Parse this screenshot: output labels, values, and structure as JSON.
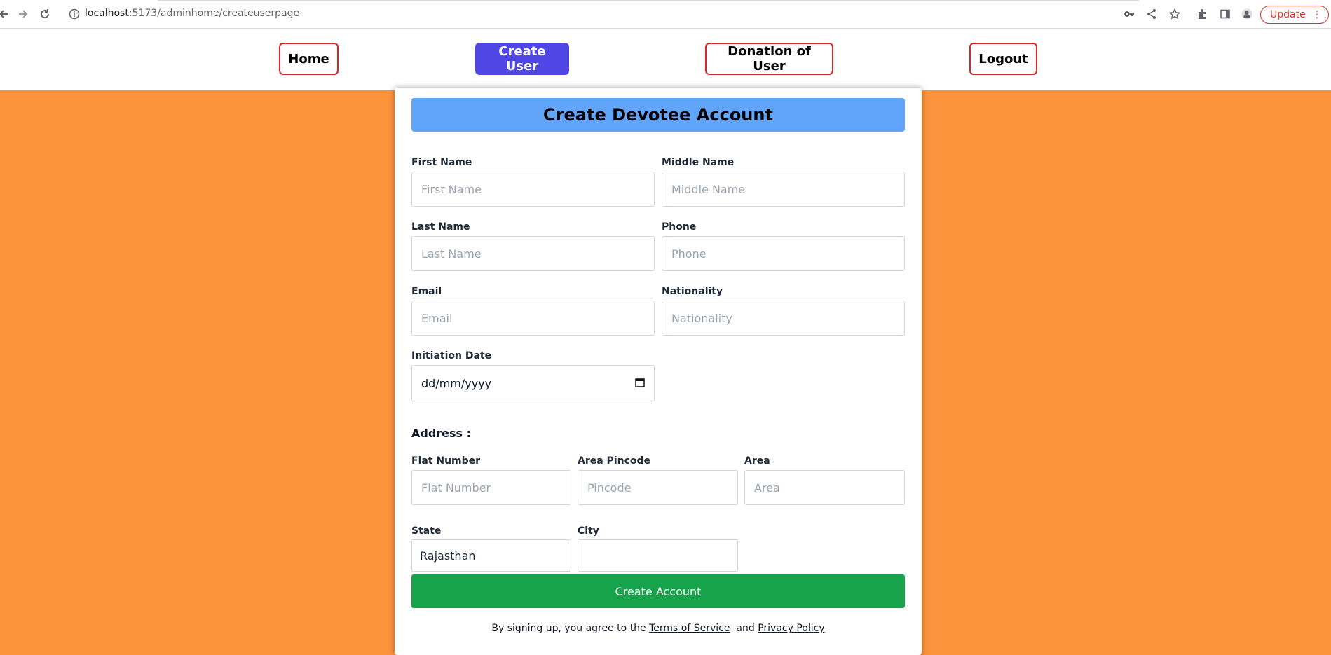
{
  "browser": {
    "url_host": "localhost",
    "url_path": ":5173/adminhome/createuserpage",
    "update_label": "Update",
    "colors": {
      "update": "#d93025"
    }
  },
  "nav": {
    "home": "Home",
    "create_user": "Create User",
    "donation": "Donation of User",
    "logout": "Logout",
    "colors": {
      "active_bg": "#4f46e5",
      "border": "#dc2626"
    }
  },
  "form": {
    "title": "Create Devotee Account",
    "fields": {
      "first_name": {
        "label": "First Name",
        "placeholder": "First Name"
      },
      "middle_name": {
        "label": "Middle Name",
        "placeholder": "Middle Name"
      },
      "last_name": {
        "label": "Last Name",
        "placeholder": "Last Name"
      },
      "phone": {
        "label": "Phone",
        "placeholder": "Phone"
      },
      "email": {
        "label": "Email",
        "placeholder": "Email"
      },
      "nationality": {
        "label": "Nationality",
        "placeholder": "Nationality"
      },
      "initiation_date": {
        "label": "Initiation Date",
        "value": "dd/mm/yyyy"
      }
    },
    "address": {
      "heading": "Address :",
      "flat": {
        "label": "Flat Number",
        "placeholder": "Flat Number"
      },
      "pincode": {
        "label": "Area Pincode",
        "placeholder": "Pincode"
      },
      "area": {
        "label": "Area",
        "placeholder": "Area"
      },
      "state": {
        "label": "State",
        "value": "Rajasthan"
      },
      "city": {
        "label": "City",
        "value": ""
      }
    },
    "submit_label": "Create Account",
    "terms": {
      "prefix": "By signing up, you agree to the",
      "tos": "Terms of Service",
      "and": "and",
      "privacy": "Privacy Policy"
    },
    "colors": {
      "title_bg": "#60a5fa",
      "submit_bg": "#16a34a",
      "page_bg": "#fb923c"
    }
  }
}
